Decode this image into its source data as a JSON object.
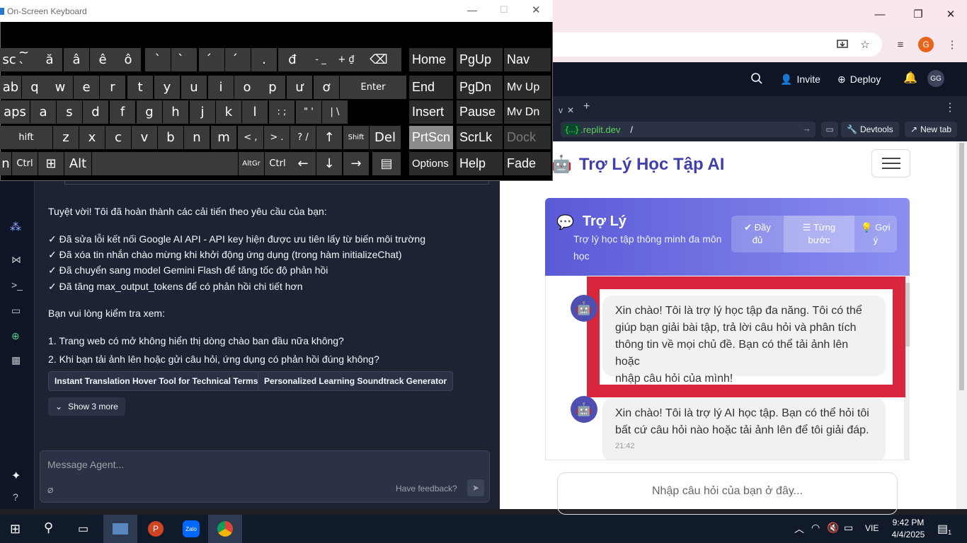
{
  "osk": {
    "title": "On-Screen Keyboard",
    "rows": [
      [
        "sc",
        "~ `",
        "ă",
        "â",
        "ê",
        "ô",
        "`",
        "̀",
        "́",
        "́",
        ".",
        "đ",
        "-  _",
        "+  ₫",
        "⌫"
      ],
      [
        "ab",
        "q",
        "w",
        "e",
        "r",
        "t",
        "y",
        "u",
        "i",
        "o",
        "p",
        "ư",
        "ơ",
        "Enter"
      ],
      [
        "aps",
        "a",
        "s",
        "d",
        "f",
        "g",
        "h",
        "j",
        "k",
        "l",
        ":  ;",
        "\"  '",
        "|  \\"
      ],
      [
        "hift",
        "z",
        "x",
        "c",
        "v",
        "b",
        "n",
        "m",
        "<  ,",
        ">  .",
        "?  /",
        "↑",
        "Shift",
        "Del"
      ],
      [
        "n",
        "Ctrl",
        "⊞",
        "Alt",
        "",
        "AltGr",
        "Ctrl",
        "←",
        "↓",
        "→",
        "▤"
      ]
    ],
    "nav": [
      [
        "Home",
        "PgUp",
        "Nav"
      ],
      [
        "End",
        "PgDn",
        "Mv Up"
      ],
      [
        "Insert",
        "Pause",
        "Mv Dn"
      ],
      [
        "PrtScn",
        "ScrLk",
        "Dock"
      ],
      [
        "Options",
        "Help",
        "Fade"
      ]
    ]
  },
  "browser": {
    "controls": {
      "minimize": "—",
      "maximize": "❐",
      "close": "✕"
    },
    "profile_initial": "G"
  },
  "replit": {
    "header": {
      "invite": "Invite",
      "deploy": "Deploy",
      "avatar": "GG"
    },
    "preview_bar": {
      "tab_close": "✕",
      "tab_add": "+",
      "url_badge": "{...}",
      "url_host": ".replit.dev",
      "url_path": "/",
      "devtools": "Devtools",
      "new_tab": "New tab"
    },
    "agent": {
      "intro": "Tuyệt vời! Tôi đã hoàn thành các cải tiến theo yêu cầu của bạn:",
      "checks": [
        "✓ Đã sửa lỗi kết nối Google AI API - API key hiện được ưu tiên lấy từ biến môi trường",
        "✓ Đã xóa tin nhắn chào mừng khi khởi động ứng dụng (trong hàm initializeChat)",
        "✓ Đã chuyển sang model Gemini Flash để tăng tốc độ phản hồi",
        "✓ Đã tăng max_output_tokens để có phản hồi chi tiết hơn"
      ],
      "ask": "Bạn vui lòng kiểm tra xem:",
      "questions": [
        "1. Trang web có mở không hiển thị dòng chào ban đầu nữa không?",
        "2. Khi bạn tải ảnh lên hoặc gửi câu hỏi, ứng dụng có phản hồi đúng không?"
      ],
      "suggestions": [
        "Instant Translation Hover Tool for Technical Terms",
        "Personalized Learning Soundtrack Generator"
      ],
      "show_more": "Show 3 more",
      "input_placeholder": "Message Agent...",
      "feedback": "Have feedback?"
    }
  },
  "app": {
    "brand": "Trợ Lý Học Tập AI",
    "card_title": "Trợ Lý",
    "card_subtitle_1": "Trợ lý học tập thông minh đa môn",
    "card_subtitle_2": "học",
    "modes": [
      {
        "l1": "Đầy",
        "l2": "đủ",
        "icon": "✔"
      },
      {
        "l1": "Từng",
        "l2": "bước",
        "icon": "☰"
      },
      {
        "l1": "Gợi",
        "l2": "ý",
        "icon": "💡"
      }
    ],
    "msg1": [
      "Xin chào! Tôi là trợ lý học tập đa năng. Tôi có thể",
      "giúp bạn giải bài tập, trả lời câu hỏi và phân tích",
      "thông tin về mọi chủ đề. Bạn có thể tải ảnh lên hoặc",
      "nhập câu hỏi của mình!"
    ],
    "msg2": [
      "Xin chào! Tôi là trợ lý AI học tập. Bạn có thể hỏi tôi",
      "bất cứ câu hỏi nào hoặc tải ảnh lên để tôi giải đáp."
    ],
    "msg2_time": "21:42",
    "input_placeholder": "Nhập câu hỏi của bạn ở đây...",
    "highlight_color": "#d8263d"
  },
  "taskbar": {
    "time": "9:42 PM",
    "date": "4/4/2025",
    "lang": "VIE",
    "notif_count": "1",
    "apps": [
      "file-explorer-icon",
      "powerpoint-icon",
      "zalo-icon",
      "chrome-icon"
    ]
  }
}
